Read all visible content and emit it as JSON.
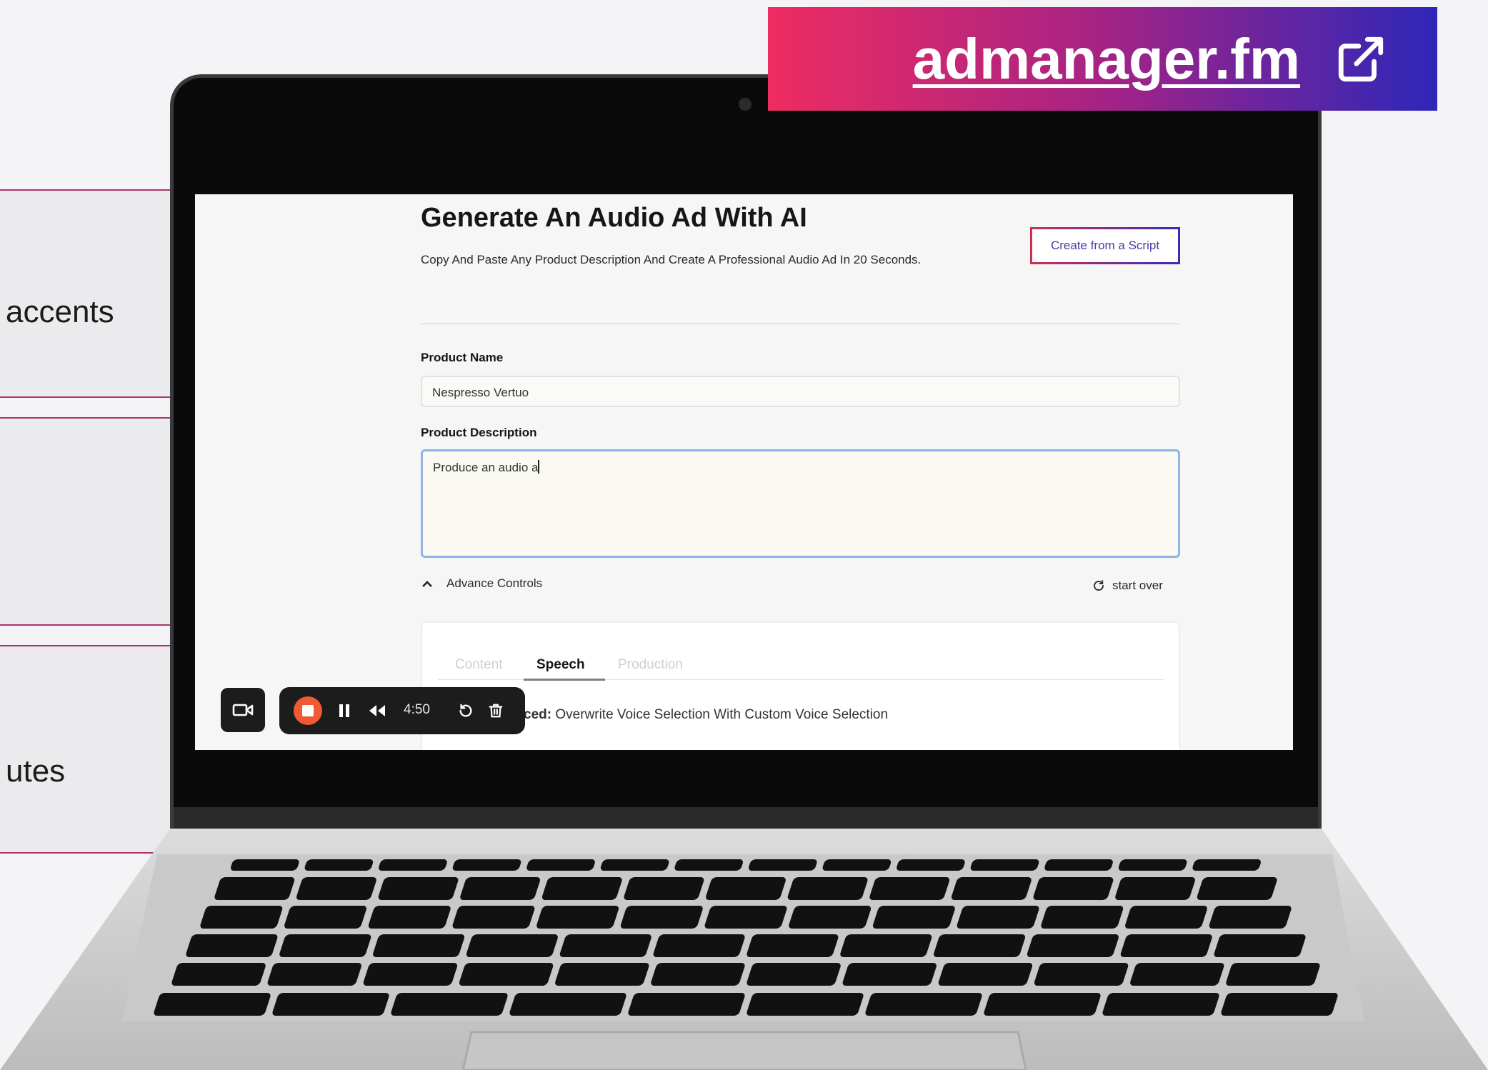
{
  "side_features": [
    {
      "text": "accents"
    },
    {
      "text": ""
    },
    {
      "text": "utes"
    }
  ],
  "banner": {
    "link_text": "admanager.fm",
    "icon": "external-link-icon"
  },
  "screen": {
    "title": "Generate An Audio Ad With AI",
    "subtitle": "Copy And Paste Any Product Description And Create A Professional Audio Ad In 20 Seconds.",
    "create_script_button": "Create from a Script",
    "product_name": {
      "label": "Product Name",
      "value": "Nespresso Vertuo"
    },
    "product_description": {
      "label": "Product Description",
      "value": "Produce an audio a"
    },
    "advance_controls": "Advance Controls",
    "start_over": "start over",
    "tabs": [
      {
        "label": "Content",
        "active": false
      },
      {
        "label": "Speech",
        "active": true
      },
      {
        "label": "Production",
        "active": false
      }
    ],
    "advanced_prefix": "ced:",
    "advanced_text": " Overwrite Voice Selection With Custom Voice Selection"
  },
  "recorder": {
    "timer": "4:50"
  },
  "colors": {
    "banner_start": "#ee2c62",
    "banner_end": "#2d27b8",
    "accent_line": "#b0336f",
    "record": "#ef5a32"
  }
}
